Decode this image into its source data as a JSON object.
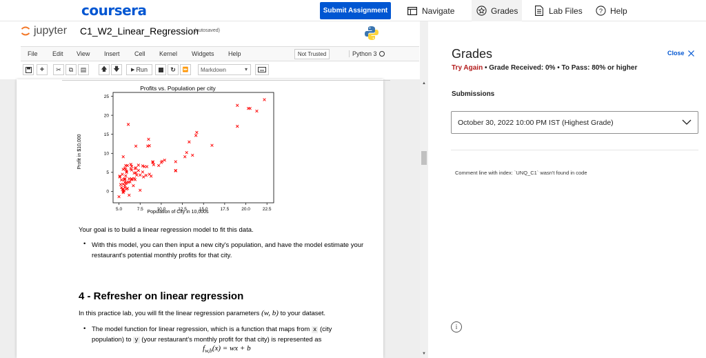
{
  "coursera": {
    "logo": "coursera",
    "submit_label": "Submit Assignment",
    "nav": {
      "navigate": "Navigate",
      "grades": "Grades",
      "lab_files": "Lab Files",
      "help": "Help"
    }
  },
  "notebook": {
    "brand": "jupyter",
    "title": "C1_W2_Linear_Regression",
    "save_status": "(autosaved)",
    "menu": [
      "File",
      "Edit",
      "View",
      "Insert",
      "Cell",
      "Kernel",
      "Widgets",
      "Help"
    ],
    "trust": "Not Trusted",
    "kernel": "Python 3",
    "toolbar": {
      "run_label": "Run",
      "cell_type": "Markdown"
    },
    "content": {
      "goal_text": "Your goal is to build a linear regression model to fit this data.",
      "bullet1_line1": "With this model, you can then input a new city's population, and have the model estimate your",
      "bullet1_line2": "restaurant's potential monthly profits for that city.",
      "heading": "4 - Refresher on linear regression",
      "intro_pre": "In this practice lab, you will fit the linear regression parameters ",
      "intro_math": "(w, b)",
      "intro_post": " to your dataset.",
      "bullet2_a": "The model function for linear regression, which is a function that maps from ",
      "bullet2_code_x": "x",
      "bullet2_b": " (city",
      "bullet2_c": "population) to ",
      "bullet2_code_y": "y",
      "bullet2_d": " (your restaurant's monthly profit for that city) is represented as",
      "formula": "f_{w,b}(x) = wx + b"
    }
  },
  "chart_data": {
    "type": "scatter",
    "title": "Profits vs. Population per city",
    "xlabel": "Population of City in 10,000s",
    "ylabel": "Profit in $10,000",
    "xlim": [
      4.3,
      23.3
    ],
    "ylim": [
      -3.0,
      26.0
    ],
    "xticks": [
      "5.0",
      "7.5",
      "10.0",
      "12.5",
      "15.0",
      "17.5",
      "20.0",
      "22.5"
    ],
    "xtick_values": [
      5.0,
      7.5,
      10.0,
      12.5,
      15.0,
      17.5,
      20.0,
      22.5
    ],
    "yticks": [
      "0",
      "5",
      "10",
      "15",
      "20",
      "25"
    ],
    "ytick_values": [
      0,
      5,
      10,
      15,
      20,
      25
    ],
    "marker": "x",
    "color": "#ff0000",
    "x": [
      6.1,
      5.5,
      8.5,
      7.0,
      5.8,
      8.4,
      7.5,
      8.6,
      6.5,
      5.1,
      5.7,
      14.2,
      5.7,
      5.9,
      6.5,
      5.3,
      5.6,
      5.5,
      5.8,
      7.0,
      5.8,
      11.7,
      5.7,
      7.8,
      7.1,
      5.1,
      5.7,
      14.1,
      20.3,
      5.5,
      6.4,
      5.7,
      5.2,
      6.2,
      5.9,
      12.8,
      6.3,
      5.5,
      6.9,
      6.7,
      5.0,
      5.7,
      5.3,
      5.5,
      7.3,
      6.5,
      7.9,
      9.1,
      9.0,
      10.4,
      10.1,
      6.1,
      5.6,
      5.9,
      6.0,
      6.9,
      5.4,
      8.2,
      6.8,
      6.4,
      5.8,
      8.8,
      8.6,
      9.0,
      10.0,
      11.7,
      13.0,
      13.3,
      13.7,
      16.0,
      19.0,
      19.0,
      20.5,
      21.3,
      22.2,
      6.2,
      5.7,
      7.3,
      5.4,
      5.5,
      6.0,
      5.9,
      6.8,
      7.5,
      9.7,
      11.7,
      6.5,
      7.0,
      8.0,
      7.8,
      8.3
    ],
    "y": [
      17.6,
      9.1,
      13.7,
      11.9,
      6.8,
      11.9,
      4.3,
      12.0,
      6.6,
      3.8,
      3.3,
      15.5,
      3.2,
      5.0,
      3.3,
      3.0,
      3.1,
      1.9,
      2.1,
      4.9,
      4.1,
      5.4,
      1.0,
      6.7,
      4.3,
      4.0,
      2.4,
      14.7,
      21.8,
      0.0,
      5.9,
      6.1,
      1.8,
      3.3,
      0.6,
      9.1,
      2.5,
      0.6,
      3.1,
      1.5,
      -1.4,
      3.3,
      1.0,
      -0.3,
      6.9,
      3.1,
      3.8,
      7.0,
      7.6,
      8.2,
      7.9,
      2.4,
      0.2,
      2.3,
      0.8,
      6.0,
      0.5,
      4.2,
      4.8,
      7.1,
      5.8,
      4.0,
      4.5,
      7.8,
      7.6,
      5.5,
      10.2,
      13.0,
      9.5,
      12.1,
      22.6,
      17.1,
      21.8,
      21.1,
      24.1,
      -1.0,
      1.5,
      5.5,
      4.5,
      5.8,
      6.8,
      5.3,
      3.4,
      0.3,
      6.8,
      7.8,
      5.6,
      6.2,
      6.5,
      5.1,
      6.5
    ]
  },
  "grades_panel": {
    "title": "Grades",
    "close_label": "Close",
    "status_try_again": "Try Again",
    "status_received": "Grade Received: 0%",
    "status_to_pass": "To Pass: 80% or higher",
    "submissions_label": "Submissions",
    "submission_selected": "October 30, 2022 10:00 PM IST (Highest Grade)",
    "comment": "Comment line with index: `UNQ_C1` wasn't found in code"
  }
}
